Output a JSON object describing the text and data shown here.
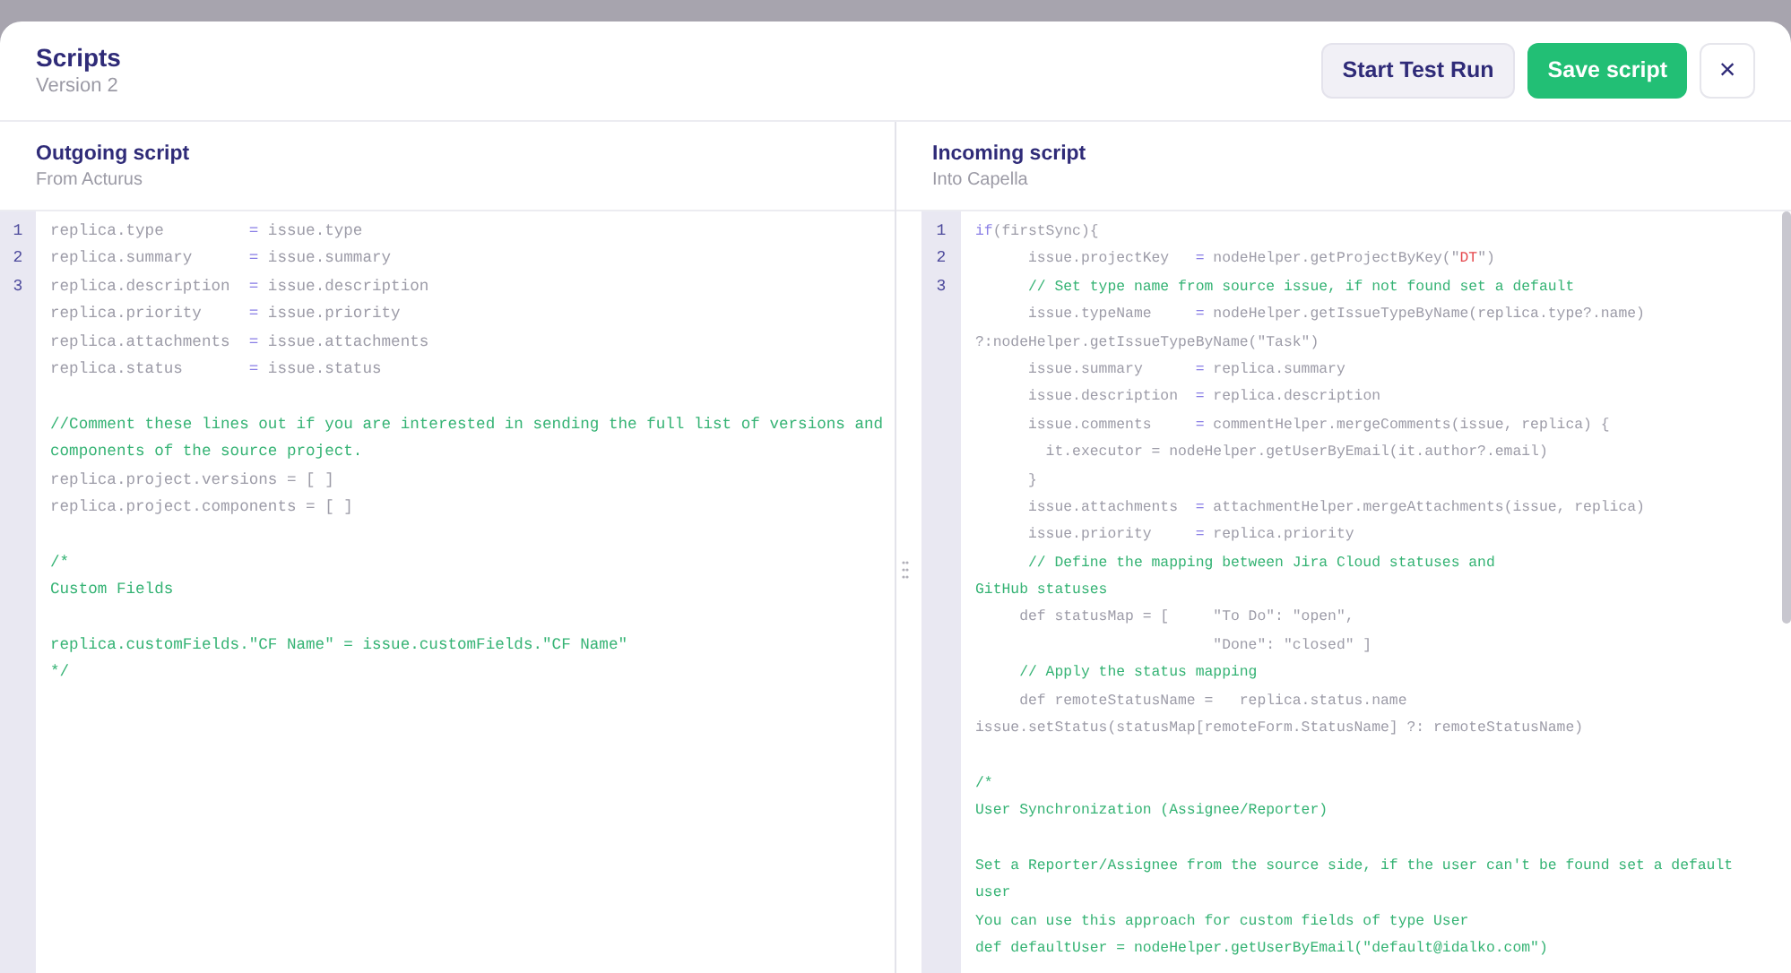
{
  "dialog": {
    "title": "Scripts",
    "subtitle": "Version 2"
  },
  "buttons": [
    {
      "kind": "secondary",
      "label": "Start Test Run"
    },
    {
      "kind": "primary",
      "label": "Save script"
    },
    {
      "kind": "close",
      "label": "×"
    }
  ],
  "panels": [
    {
      "title": "Outgoing script",
      "subtitle": "From Acturus",
      "line_numbers": [
        "1",
        "2",
        "3"
      ],
      "lines": [
        {
          "kind": "code",
          "segments": [
            {
              "kind": "code",
              "text": "replica.type         "
            },
            {
              "kind": "op",
              "text": "="
            },
            {
              "kind": "code",
              "text": " issue.type"
            }
          ]
        },
        {
          "kind": "code",
          "segments": [
            {
              "kind": "code",
              "text": "replica.summary      "
            },
            {
              "kind": "op",
              "text": "="
            },
            {
              "kind": "code",
              "text": " issue.summary"
            }
          ]
        },
        {
          "kind": "code",
          "segments": [
            {
              "kind": "code",
              "text": "replica.description  "
            },
            {
              "kind": "op",
              "text": "="
            },
            {
              "kind": "code",
              "text": " issue.description"
            }
          ]
        },
        {
          "kind": "code",
          "segments": [
            {
              "kind": "code",
              "text": "replica.priority     "
            },
            {
              "kind": "op",
              "text": "="
            },
            {
              "kind": "code",
              "text": " issue.priority"
            }
          ]
        },
        {
          "kind": "code",
          "segments": [
            {
              "kind": "code",
              "text": "replica.attachments  "
            },
            {
              "kind": "op",
              "text": "="
            },
            {
              "kind": "code",
              "text": " issue.attachments"
            }
          ]
        },
        {
          "kind": "code",
          "segments": [
            {
              "kind": "code",
              "text": "replica.status       "
            },
            {
              "kind": "op",
              "text": "="
            },
            {
              "kind": "code",
              "text": " issue.status"
            }
          ]
        },
        {
          "kind": "blank"
        },
        {
          "kind": "code",
          "segments": [
            {
              "kind": "comment",
              "text": "//Comment these lines out if you are interested in sending the full list of versions and"
            }
          ]
        },
        {
          "kind": "code",
          "segments": [
            {
              "kind": "comment",
              "text": "components of the source project."
            }
          ]
        },
        {
          "kind": "code",
          "segments": [
            {
              "kind": "code",
              "text": "replica.project.versions = [ ]"
            }
          ]
        },
        {
          "kind": "code",
          "segments": [
            {
              "kind": "code",
              "text": "replica.project.components = [ ]"
            }
          ]
        },
        {
          "kind": "blank"
        },
        {
          "kind": "code",
          "segments": [
            {
              "kind": "comment",
              "text": "/*"
            }
          ]
        },
        {
          "kind": "code",
          "segments": [
            {
              "kind": "comment",
              "text": "Custom Fields"
            }
          ]
        },
        {
          "kind": "blank"
        },
        {
          "kind": "code",
          "segments": [
            {
              "kind": "comment",
              "text": "replica.customFields.\"CF Name\" = issue.customFields.\"CF Name\""
            }
          ]
        },
        {
          "kind": "code",
          "segments": [
            {
              "kind": "comment",
              "text": "*/"
            }
          ]
        }
      ]
    },
    {
      "title": "Incoming script",
      "subtitle": "Into Capella",
      "line_numbers": [
        "1",
        "2",
        "3"
      ],
      "lines": [
        {
          "kind": "code",
          "segments": [
            {
              "kind": "op",
              "text": "if"
            },
            {
              "kind": "code",
              "text": "(firstSync){"
            }
          ]
        },
        {
          "kind": "code",
          "segments": [
            {
              "kind": "code",
              "text": "      issue.projectKey   "
            },
            {
              "kind": "op",
              "text": "="
            },
            {
              "kind": "code",
              "text": " nodeHelper.getProjectByKey(\""
            },
            {
              "kind": "string",
              "text": "DT"
            },
            {
              "kind": "code",
              "text": "\")"
            }
          ]
        },
        {
          "kind": "code",
          "segments": [
            {
              "kind": "comment",
              "text": "      // Set type name from source issue, if not found set a default"
            }
          ]
        },
        {
          "kind": "code",
          "segments": [
            {
              "kind": "code",
              "text": "      issue.typeName     "
            },
            {
              "kind": "op",
              "text": "="
            },
            {
              "kind": "code",
              "text": " nodeHelper.getIssueTypeByName(replica.type?.name)"
            }
          ]
        },
        {
          "kind": "code",
          "segments": [
            {
              "kind": "code",
              "text": "?:nodeHelper.getIssueTypeByName(\"Task\")"
            }
          ]
        },
        {
          "kind": "code",
          "segments": [
            {
              "kind": "code",
              "text": "      issue.summary      "
            },
            {
              "kind": "op",
              "text": "="
            },
            {
              "kind": "code",
              "text": " replica.summary"
            }
          ]
        },
        {
          "kind": "code",
          "segments": [
            {
              "kind": "code",
              "text": "      issue.description  "
            },
            {
              "kind": "op",
              "text": "="
            },
            {
              "kind": "code",
              "text": " replica.description"
            }
          ]
        },
        {
          "kind": "code",
          "segments": [
            {
              "kind": "code",
              "text": "      issue.comments     "
            },
            {
              "kind": "op",
              "text": "="
            },
            {
              "kind": "code",
              "text": " commentHelper.mergeComments(issue, replica) {"
            }
          ]
        },
        {
          "kind": "code",
          "segments": [
            {
              "kind": "code",
              "text": "        it.executor = nodeHelper.getUserByEmail(it.author?.email)"
            }
          ]
        },
        {
          "kind": "code",
          "segments": [
            {
              "kind": "code",
              "text": "      }"
            }
          ]
        },
        {
          "kind": "code",
          "segments": [
            {
              "kind": "code",
              "text": "      issue.attachments  "
            },
            {
              "kind": "op",
              "text": "="
            },
            {
              "kind": "code",
              "text": " attachmentHelper.mergeAttachments(issue, replica)"
            }
          ]
        },
        {
          "kind": "code",
          "segments": [
            {
              "kind": "code",
              "text": "      issue.priority     "
            },
            {
              "kind": "op",
              "text": "="
            },
            {
              "kind": "code",
              "text": " replica.priority"
            }
          ]
        },
        {
          "kind": "code",
          "segments": [
            {
              "kind": "comment",
              "text": "      // Define the mapping between Jira Cloud statuses and"
            }
          ]
        },
        {
          "kind": "code",
          "segments": [
            {
              "kind": "comment",
              "text": "GitHub statuses"
            }
          ]
        },
        {
          "kind": "code",
          "segments": [
            {
              "kind": "code",
              "text": "     def statusMap = [     \"To Do\": \"open\","
            }
          ]
        },
        {
          "kind": "code",
          "segments": [
            {
              "kind": "code",
              "text": "                           \"Done\": \"closed\" ]"
            }
          ]
        },
        {
          "kind": "code",
          "segments": [
            {
              "kind": "comment",
              "text": "     // Apply the status mapping"
            }
          ]
        },
        {
          "kind": "code",
          "segments": [
            {
              "kind": "code",
              "text": "     def remoteStatusName =   replica.status.name"
            }
          ]
        },
        {
          "kind": "code",
          "segments": [
            {
              "kind": "code",
              "text": "issue.setStatus(statusMap[remoteForm.StatusName] ?: remoteStatusName)"
            }
          ]
        },
        {
          "kind": "blank"
        },
        {
          "kind": "code",
          "segments": [
            {
              "kind": "comment",
              "text": "/*"
            }
          ]
        },
        {
          "kind": "code",
          "segments": [
            {
              "kind": "comment",
              "text": "User Synchronization (Assignee/Reporter)"
            }
          ]
        },
        {
          "kind": "blank"
        },
        {
          "kind": "code",
          "segments": [
            {
              "kind": "comment",
              "text": "Set a Reporter/Assignee from the source side, if the user can't be found set a default"
            }
          ]
        },
        {
          "kind": "code",
          "segments": [
            {
              "kind": "comment",
              "text": "user"
            }
          ]
        },
        {
          "kind": "code",
          "segments": [
            {
              "kind": "comment",
              "text": "You can use this approach for custom fields of type User"
            }
          ]
        },
        {
          "kind": "code",
          "segments": [
            {
              "kind": "comment",
              "text": "def defaultUser = nodeHelper.getUserByEmail(\"default@idalko.com\")"
            }
          ]
        }
      ]
    }
  ]
}
